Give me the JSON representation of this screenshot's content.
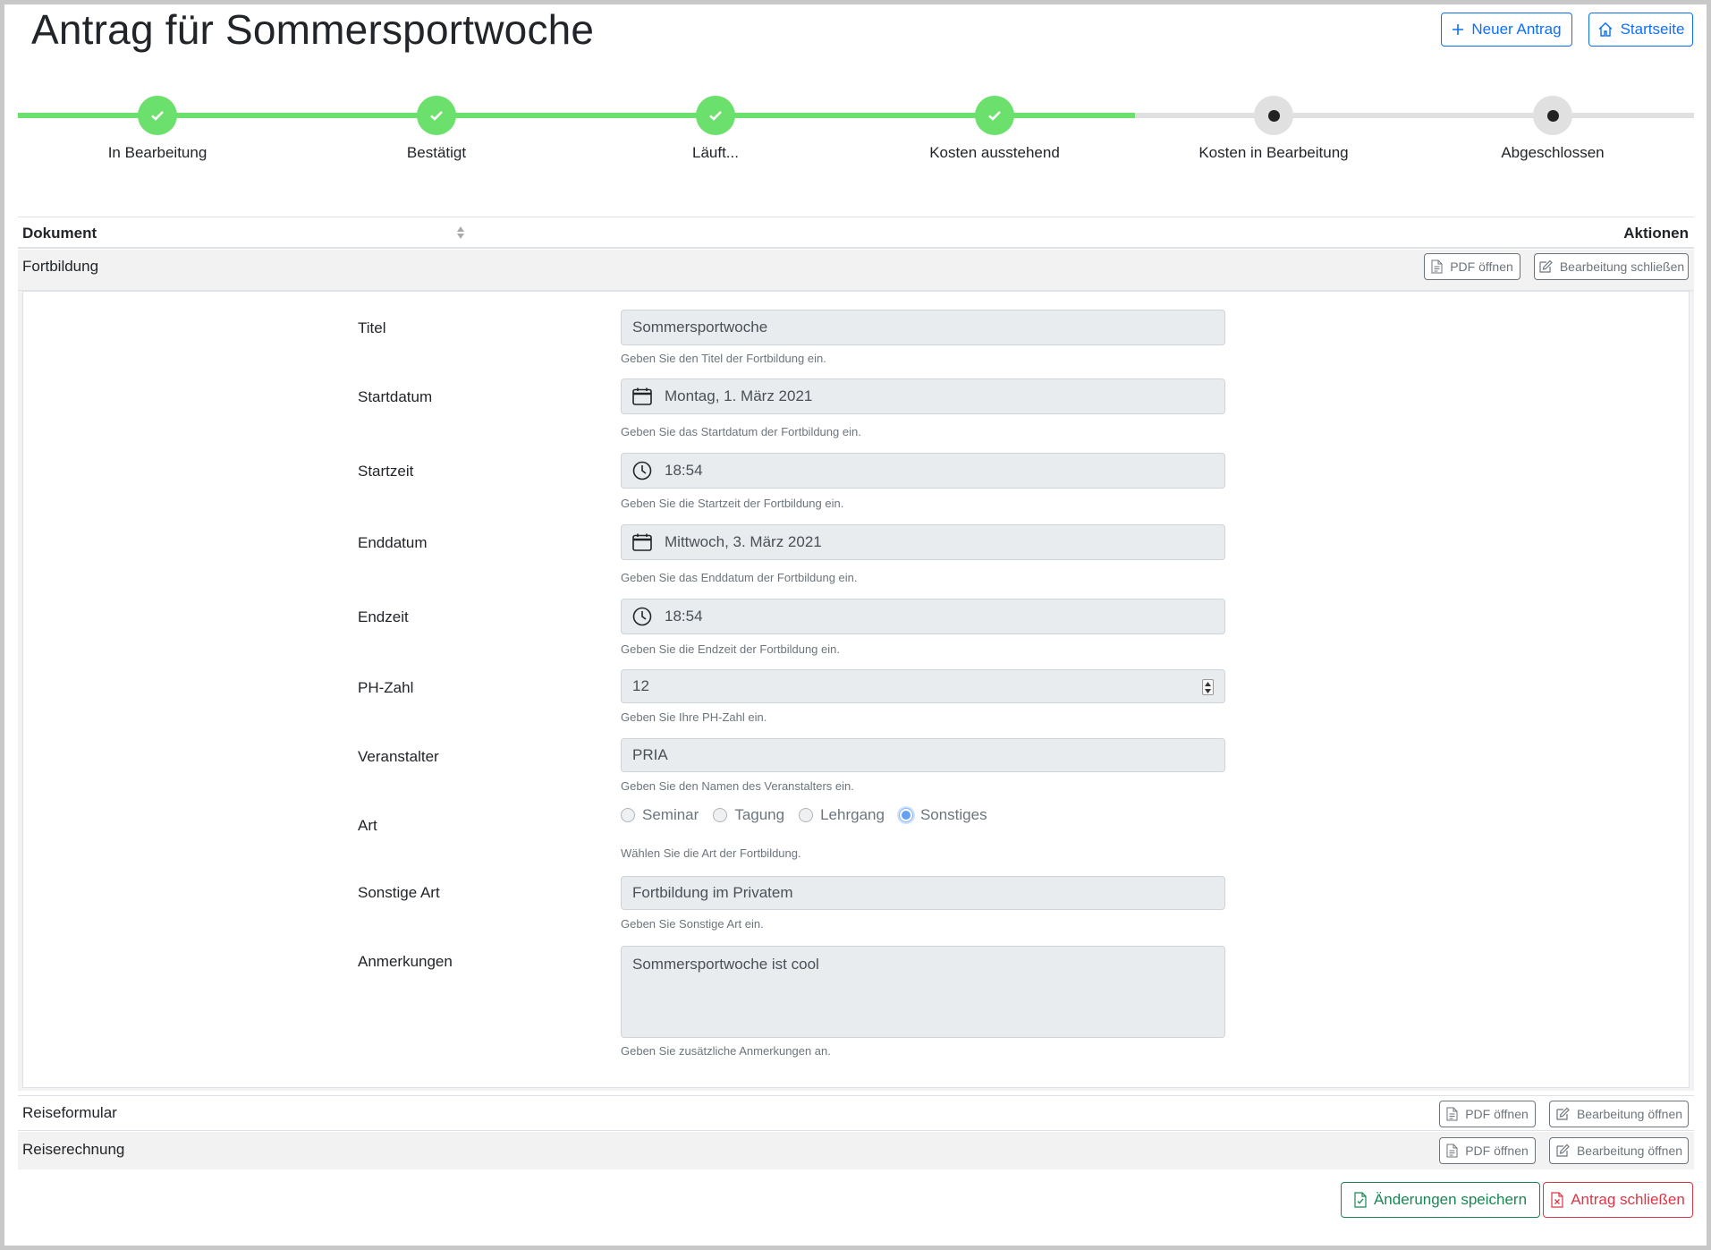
{
  "page": {
    "title": "Antrag für Sommersportwoche"
  },
  "header": {
    "new_label": "Neuer Antrag",
    "home_label": "Startseite"
  },
  "stepper": {
    "steps": [
      {
        "label": "In Bearbeitung",
        "status": "done"
      },
      {
        "label": "Bestätigt",
        "status": "done"
      },
      {
        "label": "Läuft...",
        "status": "done"
      },
      {
        "label": "Kosten ausstehend",
        "status": "done"
      },
      {
        "label": "Kosten in Bearbeitung",
        "status": "pending"
      },
      {
        "label": "Abgeschlossen",
        "status": "pending"
      }
    ],
    "colors": {
      "done": "#6ce06c",
      "pending": "#e0e0e0"
    }
  },
  "table": {
    "headers": {
      "document": "Dokument",
      "actions": "Aktionen"
    },
    "rows": [
      {
        "name": "Fortbildung",
        "pdf_label": "PDF öffnen",
        "edit_label": "Bearbeitung schließen"
      },
      {
        "name": "Reiseformular",
        "pdf_label": "PDF öffnen",
        "edit_label": "Bearbeitung öffnen"
      },
      {
        "name": "Reiserechnung",
        "pdf_label": "PDF öffnen",
        "edit_label": "Bearbeitung öffnen"
      }
    ]
  },
  "form": {
    "titel": {
      "label": "Titel",
      "value": "Sommersportwoche",
      "help": "Geben Sie den Titel der Fortbildung ein."
    },
    "startdatum": {
      "label": "Startdatum",
      "value": "Montag, 1. März 2021",
      "help": "Geben Sie das Startdatum der Fortbildung ein.",
      "icon": "calendar-icon"
    },
    "startzeit": {
      "label": "Startzeit",
      "value": "18:54",
      "help": "Geben Sie die Startzeit der Fortbildung ein.",
      "icon": "clock-icon"
    },
    "enddatum": {
      "label": "Enddatum",
      "value": "Mittwoch, 3. März 2021",
      "help": "Geben Sie das Enddatum der Fortbildung ein.",
      "icon": "calendar-icon"
    },
    "endzeit": {
      "label": "Endzeit",
      "value": "18:54",
      "help": "Geben Sie die Endzeit der Fortbildung ein.",
      "icon": "clock-icon"
    },
    "phzahl": {
      "label": "PH-Zahl",
      "value": "12",
      "help": "Geben Sie Ihre PH-Zahl ein."
    },
    "veranstalter": {
      "label": "Veranstalter",
      "value": "PRIA",
      "help": "Geben Sie den Namen des Veranstalters ein."
    },
    "art": {
      "label": "Art",
      "options": [
        "Seminar",
        "Tagung",
        "Lehrgang",
        "Sonstiges"
      ],
      "selected": "Sonstiges",
      "help": "Wählen Sie die Art der Fortbildung."
    },
    "sonstige_art": {
      "label": "Sonstige Art",
      "value": "Fortbildung im Privatem",
      "help": "Geben Sie Sonstige Art ein."
    },
    "anmerkungen": {
      "label": "Anmerkungen",
      "value": "Sommersportwoche ist cool",
      "help": "Geben Sie zusätzliche Anmerkungen an."
    }
  },
  "footer": {
    "save_label": "Änderungen speichern",
    "close_label": "Antrag schließen"
  },
  "colors": {
    "primary": "#0d6efd",
    "success": "#198754",
    "danger": "#dc3545",
    "secondary": "#6c757d"
  }
}
